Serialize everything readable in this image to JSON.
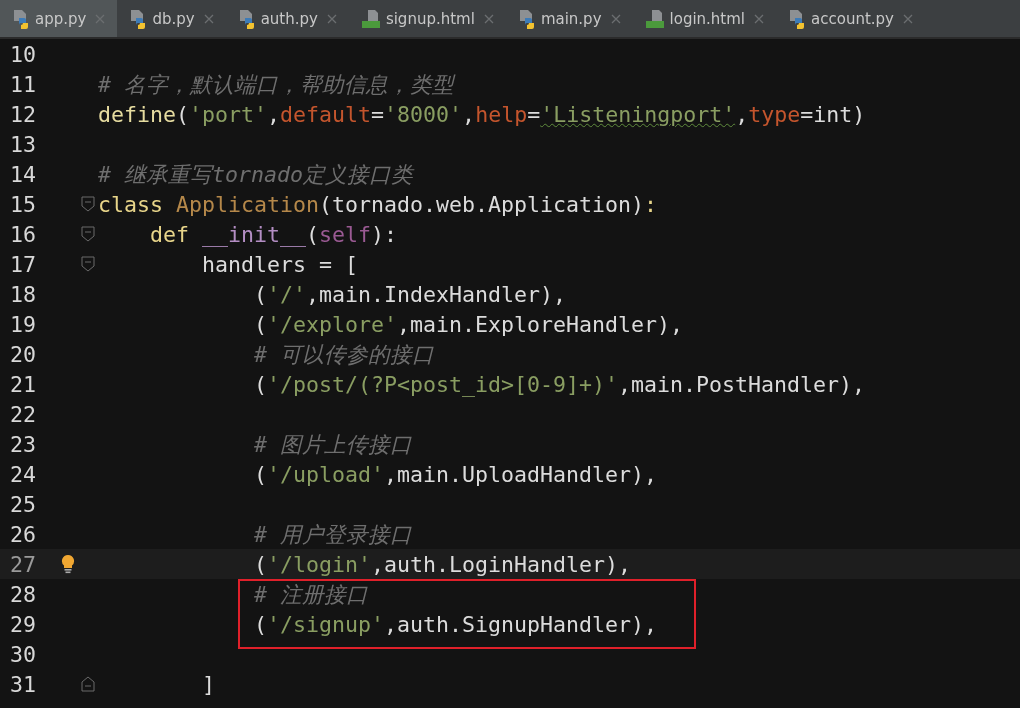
{
  "tabs": [
    {
      "label": "app.py",
      "kind": "python",
      "selected": true
    },
    {
      "label": "db.py",
      "kind": "python",
      "selected": false
    },
    {
      "label": "auth.py",
      "kind": "python",
      "selected": false
    },
    {
      "label": "signup.html",
      "kind": "html",
      "selected": false
    },
    {
      "label": "main.py",
      "kind": "python",
      "selected": false
    },
    {
      "label": "login.html",
      "kind": "html",
      "selected": false
    },
    {
      "label": "account.py",
      "kind": "python",
      "selected": false
    }
  ],
  "editor": {
    "lines": [
      {
        "number": "10"
      },
      {
        "number": "11",
        "tokens": [
          {
            "kind": "comment",
            "text": "# 名字，默认端口，帮助信息，类型"
          }
        ]
      },
      {
        "number": "12",
        "tokens": [
          {
            "kind": "call",
            "text": "define"
          },
          {
            "kind": "plain",
            "text": "("
          },
          {
            "kind": "string",
            "text": "'port'"
          },
          {
            "kind": "plain",
            "text": ","
          },
          {
            "kind": "param",
            "text": "default"
          },
          {
            "kind": "plain",
            "text": "="
          },
          {
            "kind": "string",
            "text": "'8000'"
          },
          {
            "kind": "plain",
            "text": ","
          },
          {
            "kind": "param",
            "text": "help"
          },
          {
            "kind": "plain",
            "text": "="
          },
          {
            "kind": "string",
            "text": "'Listeningport'",
            "squiggle": true
          },
          {
            "kind": "plain",
            "text": ","
          },
          {
            "kind": "param",
            "text": "type"
          },
          {
            "kind": "plain",
            "text": "=int)"
          }
        ]
      },
      {
        "number": "13"
      },
      {
        "number": "14",
        "tokens": [
          {
            "kind": "comment",
            "text": "# 继承重写tornado定义接口类"
          }
        ]
      },
      {
        "number": "15",
        "fold_start": true,
        "tokens": [
          {
            "kind": "keyword",
            "text": "class "
          },
          {
            "kind": "classname",
            "text": "Application"
          },
          {
            "kind": "plain",
            "text": "(tornado.web.Application)"
          },
          {
            "kind": "keyword",
            "text": ":"
          }
        ]
      },
      {
        "number": "16",
        "fold_start": true,
        "tokens": [
          {
            "kind": "keyword",
            "text": "    def "
          },
          {
            "kind": "dunder",
            "text": "__init__"
          },
          {
            "kind": "plain",
            "text": "("
          },
          {
            "kind": "self",
            "text": "self"
          },
          {
            "kind": "plain",
            "text": "):"
          }
        ]
      },
      {
        "number": "17",
        "fold_start": true,
        "tokens": [
          {
            "kind": "plain",
            "text": "        handlers = ["
          }
        ]
      },
      {
        "number": "18",
        "tokens": [
          {
            "kind": "plain",
            "text": "            ("
          },
          {
            "kind": "string",
            "text": "'/'"
          },
          {
            "kind": "plain",
            "text": ",main.IndexHandler),"
          }
        ]
      },
      {
        "number": "19",
        "tokens": [
          {
            "kind": "plain",
            "text": "            ("
          },
          {
            "kind": "string",
            "text": "'/explore'"
          },
          {
            "kind": "plain",
            "text": ",main.ExploreHandler),"
          }
        ]
      },
      {
        "number": "20",
        "tokens": [
          {
            "kind": "comment",
            "text": "            # 可以传参的接口"
          }
        ]
      },
      {
        "number": "21",
        "tokens": [
          {
            "kind": "plain",
            "text": "            ("
          },
          {
            "kind": "string",
            "text": "'/post/(?P<post_id>[0-9]+)'"
          },
          {
            "kind": "plain",
            "text": ",main.PostHandler),"
          }
        ]
      },
      {
        "number": "22"
      },
      {
        "number": "23",
        "tokens": [
          {
            "kind": "comment",
            "text": "            # 图片上传接口"
          }
        ]
      },
      {
        "number": "24",
        "tokens": [
          {
            "kind": "plain",
            "text": "            ("
          },
          {
            "kind": "string",
            "text": "'/upload'"
          },
          {
            "kind": "plain",
            "text": ",main.UploadHandler),"
          }
        ]
      },
      {
        "number": "25"
      },
      {
        "number": "26",
        "tokens": [
          {
            "kind": "comment",
            "text": "            # 用户登录接口"
          }
        ]
      },
      {
        "number": "27",
        "current": true,
        "bulb": true,
        "tokens": [
          {
            "kind": "plain",
            "text": "            ("
          },
          {
            "kind": "string",
            "text": "'/login'"
          },
          {
            "kind": "plain",
            "text": ",auth.LoginHandler),"
          }
        ]
      },
      {
        "number": "28",
        "boxed": true,
        "tokens": [
          {
            "kind": "comment",
            "text": "            # 注册接口"
          }
        ]
      },
      {
        "number": "29",
        "boxed": true,
        "tokens": [
          {
            "kind": "plain",
            "text": "            ("
          },
          {
            "kind": "string",
            "text": "'/signup'"
          },
          {
            "kind": "plain",
            "text": ",auth.SignupHandler),"
          }
        ]
      },
      {
        "number": "30"
      },
      {
        "number": "31",
        "fold_end": true,
        "tokens": [
          {
            "kind": "plain",
            "text": "        ]"
          }
        ]
      }
    ]
  }
}
